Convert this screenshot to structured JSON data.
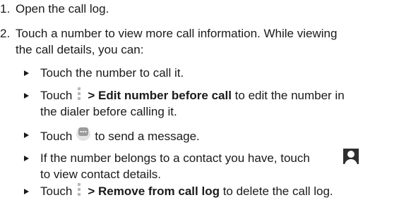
{
  "steps": [
    {
      "number": "1.",
      "text": "Open the call log."
    },
    {
      "number": "2.",
      "line1": "Touch a number to view more call information. While viewing",
      "line2": "the call details, you can:"
    }
  ],
  "bullets": [
    {
      "text": "Touch the number to call it."
    },
    {
      "prefix": "Touch",
      "icon": "menu-icon",
      "bold": "> Edit number before call",
      "suffix": " to edit the number in",
      "line2": "the dialer before calling it."
    },
    {
      "prefix": "Touch",
      "icon": "message-icon",
      "suffix": "to send a message."
    },
    {
      "line1": "If the number belongs to a contact you have, touch",
      "icon": "contact-icon",
      "line2": "to view contact details."
    },
    {
      "prefix": "Touch",
      "icon": "menu-icon",
      "bold": "> Remove from call log",
      "suffix": " to delete the call log."
    }
  ]
}
